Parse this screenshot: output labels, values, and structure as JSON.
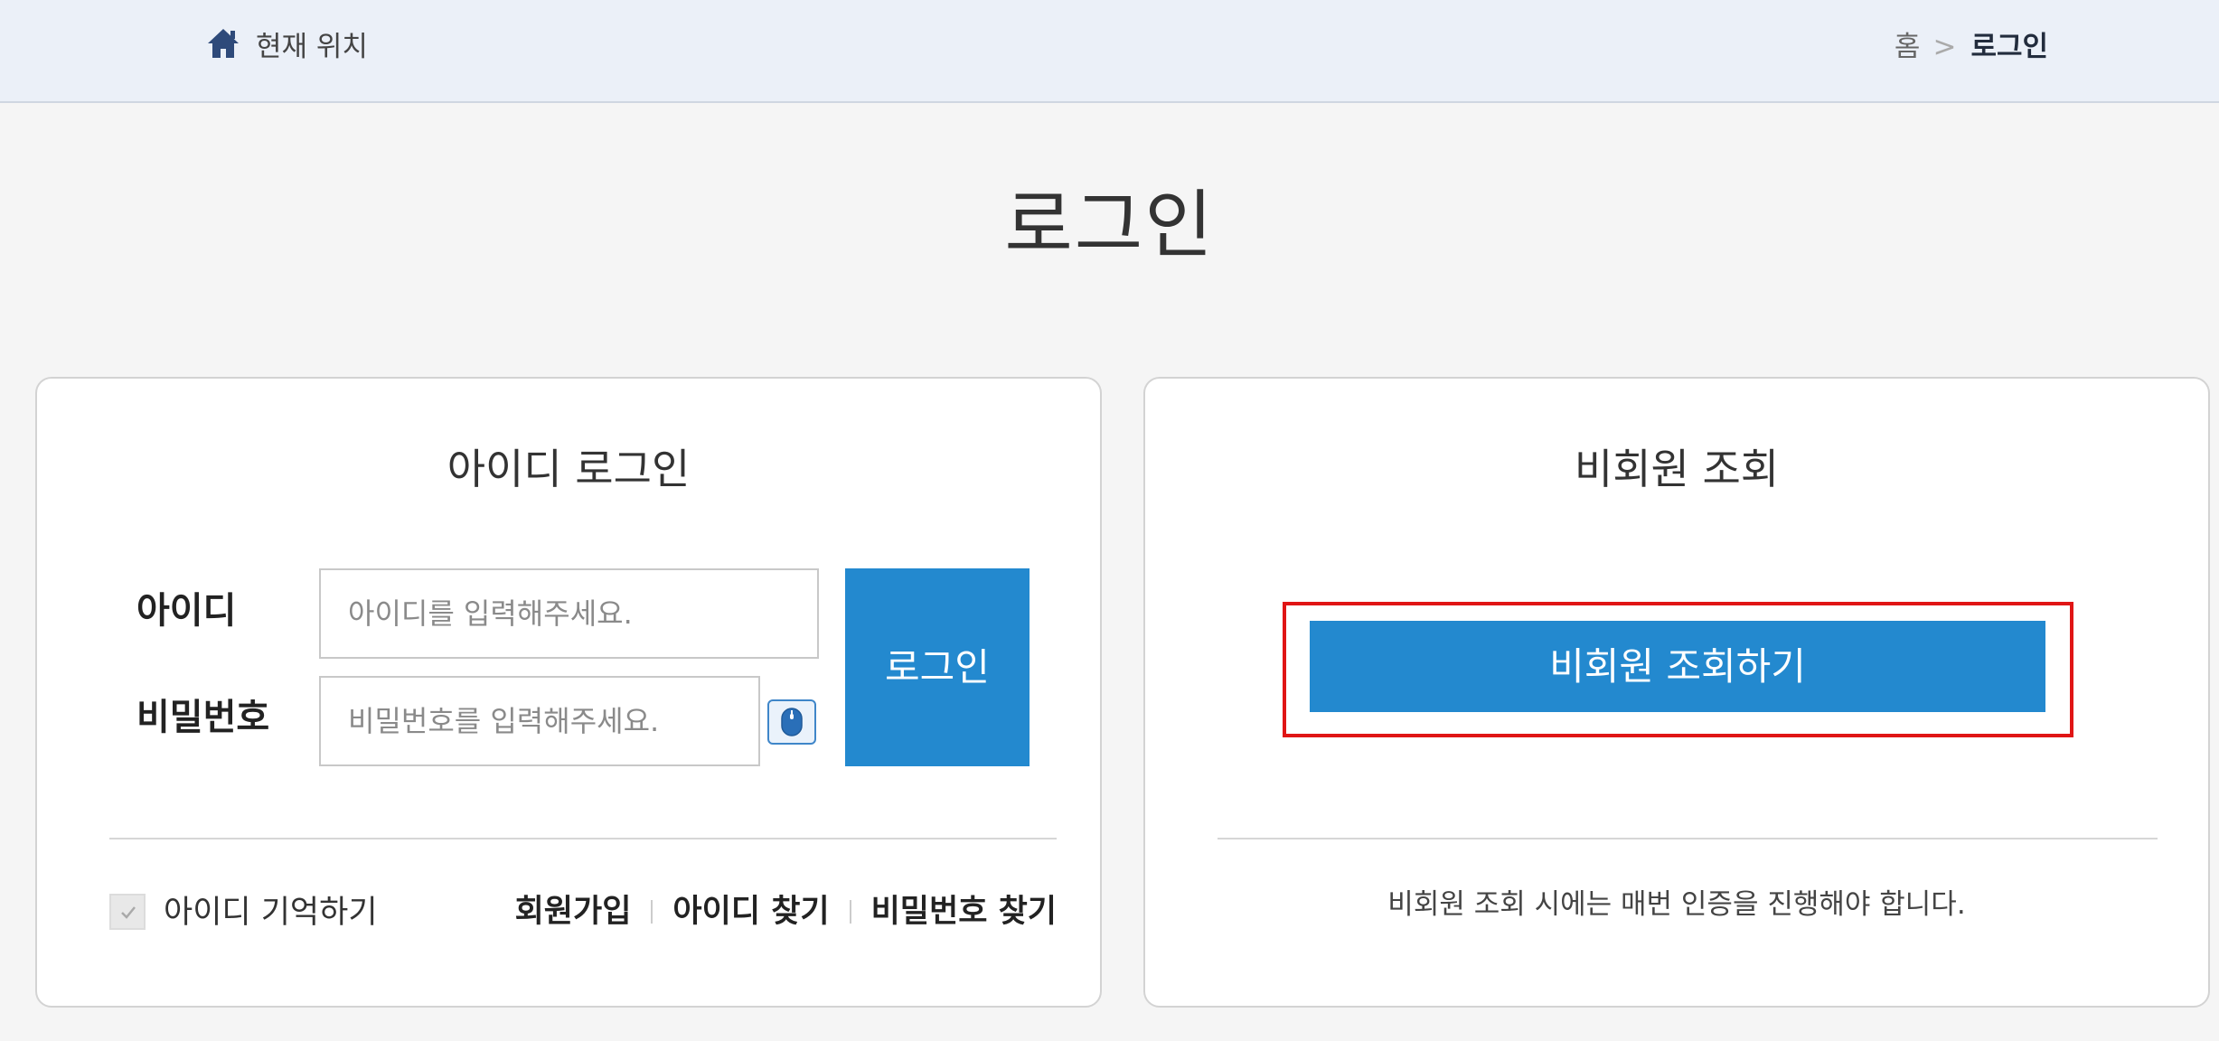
{
  "location_bar": {
    "icon": "home-icon",
    "label": "현재 위치",
    "breadcrumb": {
      "home": "홈",
      "separator": ">",
      "current": "로그인"
    }
  },
  "page": {
    "title": "로그인"
  },
  "id_login": {
    "title": "아이디 로그인",
    "id_label": "아이디",
    "id_placeholder": "아이디를 입력해주세요.",
    "password_label": "비밀번호",
    "password_placeholder": "비밀번호를 입력해주세요.",
    "mouse_icon": "mouse-icon",
    "login_button": "로그인",
    "remember_checked": true,
    "remember_label": "아이디 기억하기",
    "links": [
      "회원가입",
      "아이디 찾기",
      "비밀번호 찾기"
    ]
  },
  "guest_lookup": {
    "title": "비회원 조회",
    "button": "비회원 조회하기",
    "notice": "비회원 조회 시에는 매번 인증을 진행해야 합니다."
  },
  "colors": {
    "primary": "#2389cf",
    "highlight": "#e01515",
    "topbar_bg": "#ebf0f8"
  }
}
